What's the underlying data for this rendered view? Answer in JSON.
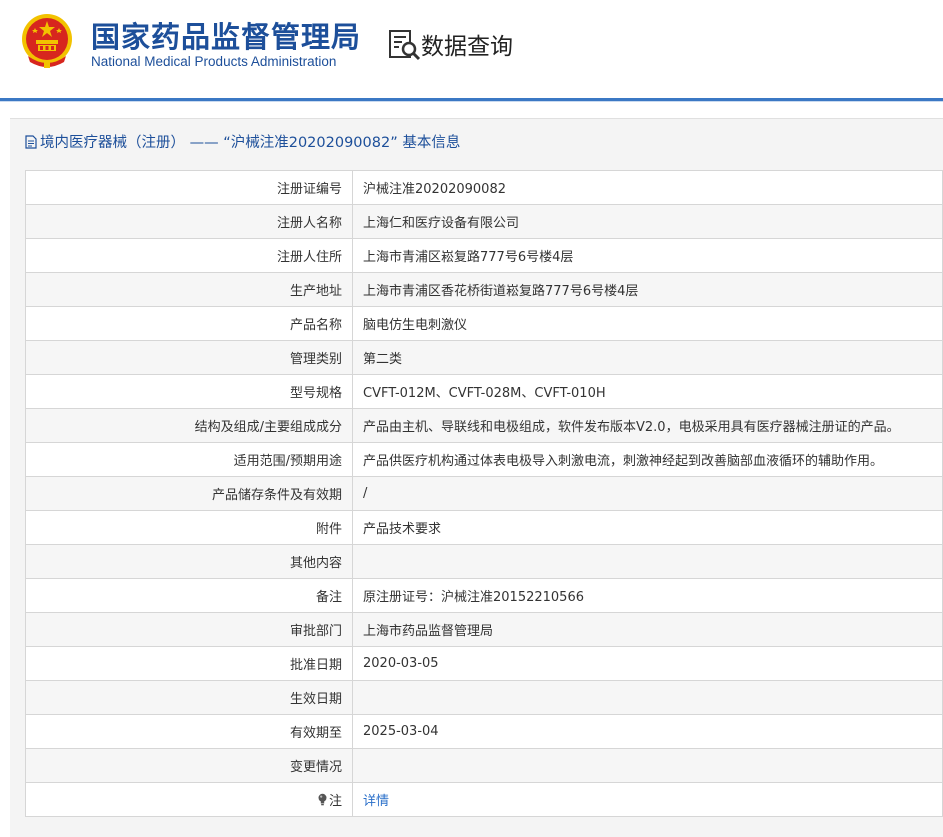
{
  "header": {
    "org_name_cn": "国家药品监督管理局",
    "org_name_en": "National Medical Products Administration",
    "section_title": "数据查询"
  },
  "panel": {
    "title": "境内医疗器械（注册） ——  “沪械注准20202090082” 基本信息"
  },
  "rows": [
    {
      "label": "注册证编号",
      "value": "沪械注准20202090082"
    },
    {
      "label": "注册人名称",
      "value": "上海仁和医疗设备有限公司"
    },
    {
      "label": "注册人住所",
      "value": "上海市青浦区崧复路777号6号楼4层"
    },
    {
      "label": "生产地址",
      "value": "上海市青浦区香花桥街道崧复路777号6号楼4层"
    },
    {
      "label": "产品名称",
      "value": "脑电仿生电刺激仪"
    },
    {
      "label": "管理类别",
      "value": "第二类"
    },
    {
      "label": "型号规格",
      "value": "CVFT-012M、CVFT-028M、CVFT-010H"
    },
    {
      "label": "结构及组成/主要组成成分",
      "value": "产品由主机、导联线和电极组成，软件发布版本V2.0，电极采用具有医疗器械注册证的产品。"
    },
    {
      "label": "适用范围/预期用途",
      "value": "产品供医疗机构通过体表电极导入刺激电流，刺激神经起到改善脑部血液循环的辅助作用。"
    },
    {
      "label": "产品储存条件及有效期",
      "value": "/"
    },
    {
      "label": "附件",
      "value": "产品技术要求"
    },
    {
      "label": "其他内容",
      "value": ""
    },
    {
      "label": "备注",
      "value": "原注册证号：沪械注准20152210566"
    },
    {
      "label": "审批部门",
      "value": "上海市药品监督管理局"
    },
    {
      "label": "批准日期",
      "value": "2020-03-05"
    },
    {
      "label": "生效日期",
      "value": ""
    },
    {
      "label": "有效期至",
      "value": "2025-03-04"
    },
    {
      "label": "变更情况",
      "value": ""
    }
  ],
  "note_row": {
    "label": "注",
    "link_text": "详情"
  },
  "colors": {
    "brand_blue": "#1d4f9a",
    "link_blue": "#2a6fc9",
    "emblem_red": "#d7261e",
    "emblem_gold": "#f2c200"
  }
}
